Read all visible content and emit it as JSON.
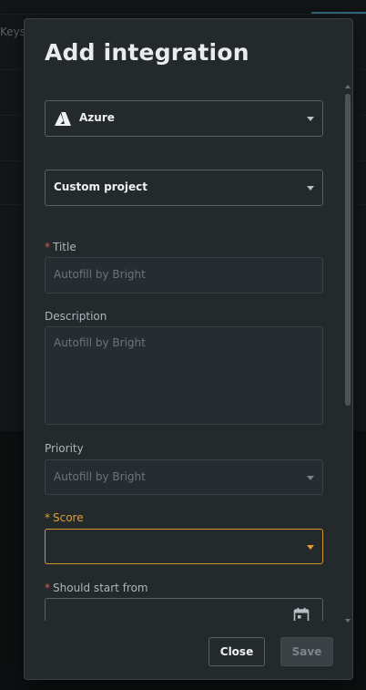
{
  "background": {
    "tab_fragment": "Keys"
  },
  "dialog": {
    "title": "Add integration",
    "integration_select": {
      "value": "Azure"
    },
    "project_select": {
      "value": "Custom project"
    },
    "title_field": {
      "label": "Title",
      "required_mark": "*",
      "placeholder": "Autofill by Bright"
    },
    "description_field": {
      "label": "Description",
      "placeholder": "Autofill by Bright"
    },
    "priority_field": {
      "label": "Priority",
      "placeholder": "Autofill by Bright"
    },
    "score_field": {
      "label": "Score",
      "required_mark": "*",
      "value": ""
    },
    "start_field": {
      "label": "Should start from",
      "required_mark": "*",
      "value": ""
    },
    "buttons": {
      "close": "Close",
      "save": "Save"
    }
  },
  "colors": {
    "accent_warning": "#e0a030",
    "required": "#e05a4e",
    "dialog_bg": "#24292c"
  },
  "icons": [
    "azure-logo-icon",
    "chevron-down-icon",
    "calendar-icon"
  ]
}
